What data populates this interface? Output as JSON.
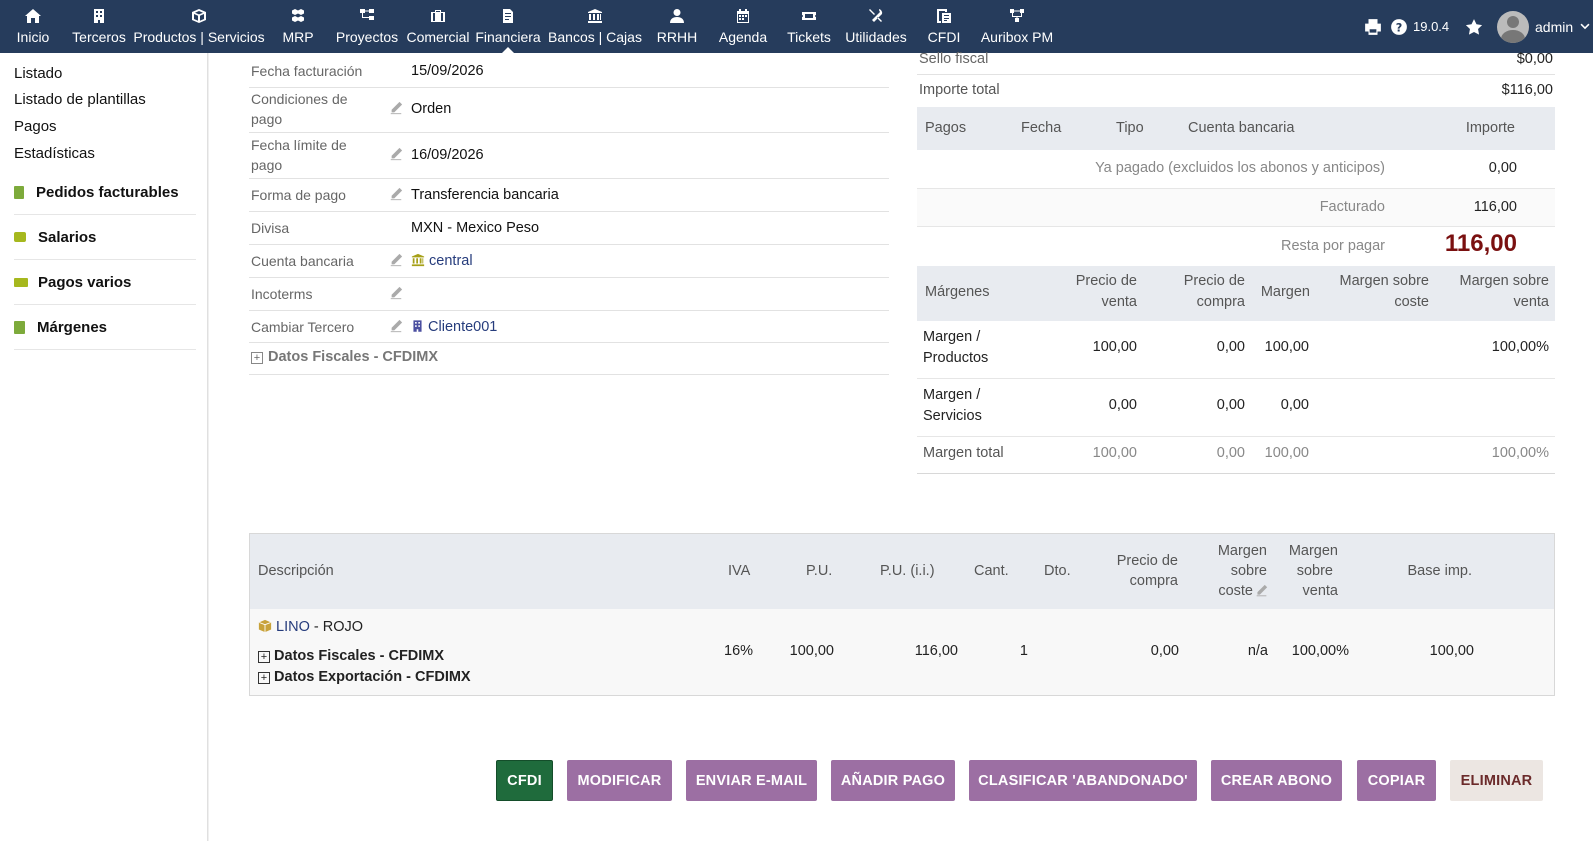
{
  "topbar": {
    "nav": [
      {
        "label": "Inicio",
        "icon": "home-icon"
      },
      {
        "label": "Terceros",
        "icon": "building-icon"
      },
      {
        "label": "Productos | Servicios",
        "icon": "cube-icon"
      },
      {
        "label": "MRP",
        "icon": "cubes-icon"
      },
      {
        "label": "Proyectos",
        "icon": "sitemap-icon"
      },
      {
        "label": "Comercial",
        "icon": "briefcase-icon"
      },
      {
        "label": "Financiera",
        "icon": "invoice-icon"
      },
      {
        "label": "Bancos | Cajas",
        "icon": "bank-icon"
      },
      {
        "label": "RRHH",
        "icon": "user-tie-icon"
      },
      {
        "label": "Agenda",
        "icon": "calendar-icon"
      },
      {
        "label": "Tickets",
        "icon": "ticket-icon"
      },
      {
        "label": "Utilidades",
        "icon": "tools-icon"
      },
      {
        "label": "CFDI",
        "icon": "cfdi-icon"
      },
      {
        "label": "Auribox PM",
        "icon": "diagram-icon"
      }
    ],
    "active": "Financiera",
    "version": "19.0.4",
    "user": "admin"
  },
  "leftmenu": {
    "items": [
      "Listado",
      "Listado de plantillas",
      "Pagos",
      "Estadísticas"
    ],
    "blocks": [
      {
        "label": "Pedidos facturables",
        "icon": "document-icon",
        "color": "#7daa3b"
      },
      {
        "label": "Salarios",
        "icon": "wallet-icon",
        "color": "#a6b81e"
      },
      {
        "label": "Pagos varios",
        "icon": "money-icon",
        "color": "#a6b81e"
      },
      {
        "label": "Márgenes",
        "icon": "calculator-icon",
        "color": "#7daa3b"
      }
    ]
  },
  "details": {
    "fecha_facturacion": {
      "label": "Fecha facturación",
      "value": "15/09/2026"
    },
    "condiciones": {
      "label1": "Condiciones de",
      "label2": "pago",
      "value": "Orden"
    },
    "fecha_limite": {
      "label1": "Fecha límite de",
      "label2": "pago",
      "value": "16/09/2026"
    },
    "forma_pago": {
      "label": "Forma de pago",
      "value": "Transferencia bancaria"
    },
    "divisa": {
      "label": "Divisa",
      "value": "MXN - Mexico Peso"
    },
    "cuenta": {
      "label": "Cuenta bancaria",
      "value": "central"
    },
    "incoterms": {
      "label": "Incoterms"
    },
    "cambiar_tercero": {
      "label": "Cambiar Tercero",
      "value": "Cliente001"
    },
    "datos_fiscales": "Datos Fiscales - CFDIMX"
  },
  "summary": {
    "sello_label": "Sello fiscal",
    "sello_value": "$0,00",
    "importe_label": "Importe total",
    "importe_value": "$116,00"
  },
  "payments": {
    "headers": [
      "Pagos",
      "Fecha",
      "Tipo",
      "Cuenta bancaria",
      "Importe"
    ],
    "ya_pagado_label": "Ya pagado (excluidos los abonos y anticipos)",
    "ya_pagado": "0,00",
    "facturado_label": "Facturado",
    "facturado": "116,00",
    "resta_label": "Resta por pagar",
    "resta": "116,00"
  },
  "margins": {
    "headers": {
      "margenes": "Márgenes",
      "pv1": "Precio de",
      "pv2": "venta",
      "pc1": "Precio de",
      "pc2": "compra",
      "margen": "Margen",
      "msc1": "Margen sobre",
      "msc2": "coste",
      "msv1": "Margen sobre",
      "msv2": "venta"
    },
    "rows": [
      {
        "l1": "Margen /",
        "l2": "Productos",
        "pv": "100,00",
        "pc": "0,00",
        "m": "100,00",
        "msc": "",
        "msv": "100,00%"
      },
      {
        "l1": "Margen /",
        "l2": "Servicios",
        "pv": "0,00",
        "pc": "0,00",
        "m": "0,00",
        "msc": "",
        "msv": ""
      },
      {
        "l1": "Margen total",
        "l2": "",
        "pv": "100,00",
        "pc": "0,00",
        "m": "100,00",
        "msc": "",
        "msv": "100,00%"
      }
    ]
  },
  "lines": {
    "headers": {
      "desc": "Descripción",
      "iva": "IVA",
      "pu": "P.U.",
      "pui": "P.U. (i.i.)",
      "cant": "Cant.",
      "dto": "Dto.",
      "pc1": "Precio de",
      "pc2": "compra",
      "msc1": "Margen",
      "msc2": "sobre",
      "msc3": "coste",
      "msv1": "Margen",
      "msv2": "sobre",
      "msv3": "venta",
      "base": "Base imp."
    },
    "row": {
      "ref": "LINO",
      "label": " - ROJO",
      "fiscal": "Datos Fiscales - CFDIMX",
      "export": "Datos Exportación - CFDIMX",
      "iva": "16%",
      "pu": "100,00",
      "pui": "116,00",
      "cant": "1",
      "pc": "0,00",
      "msc": "n/a",
      "msv": "100,00%",
      "base": "100,00"
    }
  },
  "actions": [
    "CFDI",
    "MODIFICAR",
    "ENVIAR E-MAIL",
    "AÑADIR PAGO",
    "CLASIFICAR 'ABANDONADO'",
    "CREAR ABONO",
    "COPIAR",
    "ELIMINAR"
  ]
}
